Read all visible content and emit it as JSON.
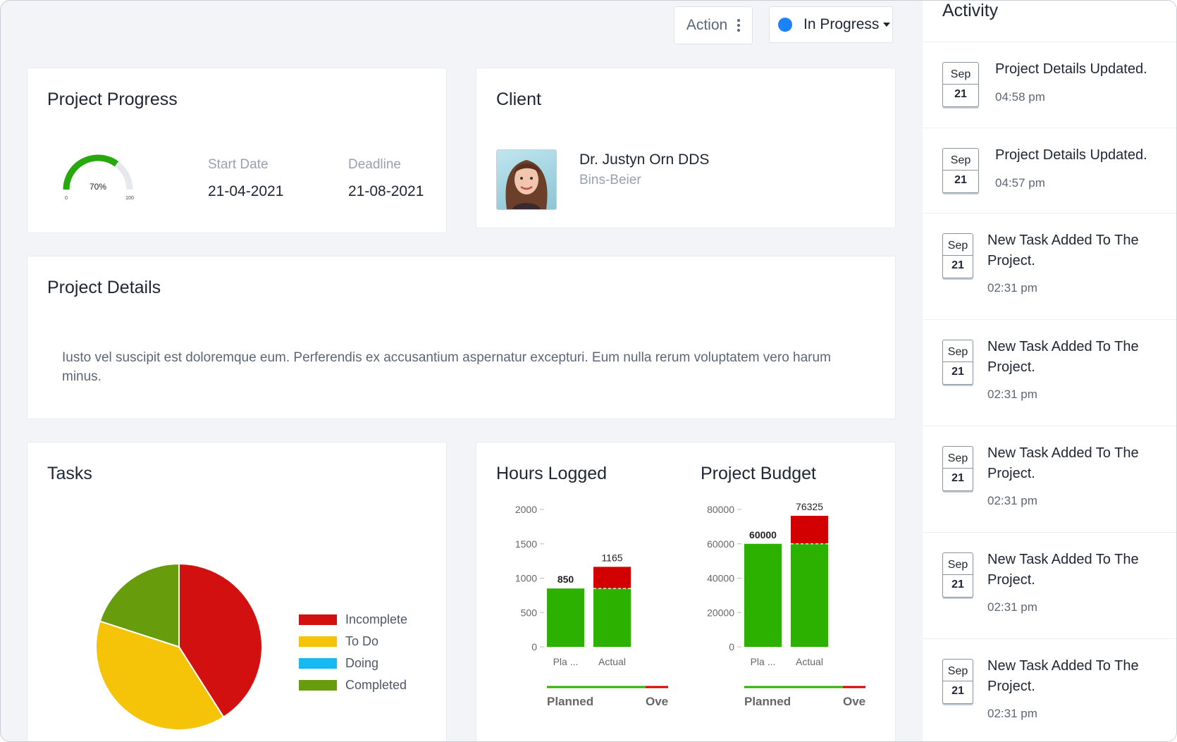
{
  "header": {
    "action_label": "Action",
    "action_icon": "kebab-vertical-icon",
    "status_label": "In Progress",
    "status_color": "#1d82f5"
  },
  "progress": {
    "title": "Project Progress",
    "gauge": {
      "value": 70,
      "label": "70%",
      "min_label": "0",
      "max_label": "100"
    },
    "start_label": "Start Date",
    "start_value": "21-04-2021",
    "deadline_label": "Deadline",
    "deadline_value": "21-08-2021"
  },
  "client": {
    "title": "Client",
    "name": "Dr. Justyn Orn DDS",
    "company": "Bins-Beier"
  },
  "details": {
    "title": "Project Details",
    "text": "Iusto vel suscipit est doloremque eum. Perferendis ex accusantium aspernatur excepturi. Eum nulla rerum voluptatem vero harum minus."
  },
  "tasks": {
    "title": "Tasks"
  },
  "hours": {
    "title": "Hours Logged"
  },
  "budget": {
    "title": "Project Budget"
  },
  "chart_data": [
    {
      "type": "pie",
      "labels": [
        "Incomplete",
        "To Do",
        "Doing",
        "Completed"
      ],
      "values": [
        41,
        39,
        0,
        20
      ],
      "colors": [
        "#d21010",
        "#f5c308",
        "#16b9f3",
        "#679c0d"
      ]
    },
    {
      "type": "bar",
      "categories": [
        "Pla ...",
        "Actual"
      ],
      "series": [
        {
          "name": "Planned",
          "values": [
            850,
            850
          ],
          "color": "#2cb100"
        },
        {
          "name": "Ove",
          "values": [
            0,
            315
          ],
          "color": "#d30000"
        }
      ],
      "data_labels": [
        "850",
        "1165"
      ],
      "yticks": [
        0,
        500,
        1000,
        1500,
        2000
      ],
      "ylim": [
        0,
        2000
      ]
    },
    {
      "type": "bar",
      "categories": [
        "Pla ...",
        "Actual"
      ],
      "series": [
        {
          "name": "Planned",
          "values": [
            60000,
            60000
          ],
          "color": "#2cb100"
        },
        {
          "name": "Ove",
          "values": [
            0,
            16325
          ],
          "color": "#d30000"
        }
      ],
      "data_labels": [
        "60000",
        "76325"
      ],
      "yticks": [
        0,
        20000,
        40000,
        60000,
        80000
      ],
      "ylim": [
        0,
        80000
      ]
    }
  ],
  "activity": {
    "title": "Activity",
    "items": [
      {
        "month": "Sep",
        "day": "21",
        "text": "Project Details Updated.",
        "time": "04:58 pm"
      },
      {
        "month": "Sep",
        "day": "21",
        "text": "Project Details Updated.",
        "time": "04:57 pm"
      },
      {
        "month": "Sep",
        "day": "21",
        "text": "New Task Added To The Project.",
        "time": "02:31 pm"
      },
      {
        "month": "Sep",
        "day": "21",
        "text": "New Task Added To The Project.",
        "time": "02:31 pm"
      },
      {
        "month": "Sep",
        "day": "21",
        "text": "New Task Added To The Project.",
        "time": "02:31 pm"
      },
      {
        "month": "Sep",
        "day": "21",
        "text": "New Task Added To The Project.",
        "time": "02:31 pm"
      },
      {
        "month": "Sep",
        "day": "21",
        "text": "New Task Added To The Project.",
        "time": "02:31 pm"
      }
    ]
  }
}
